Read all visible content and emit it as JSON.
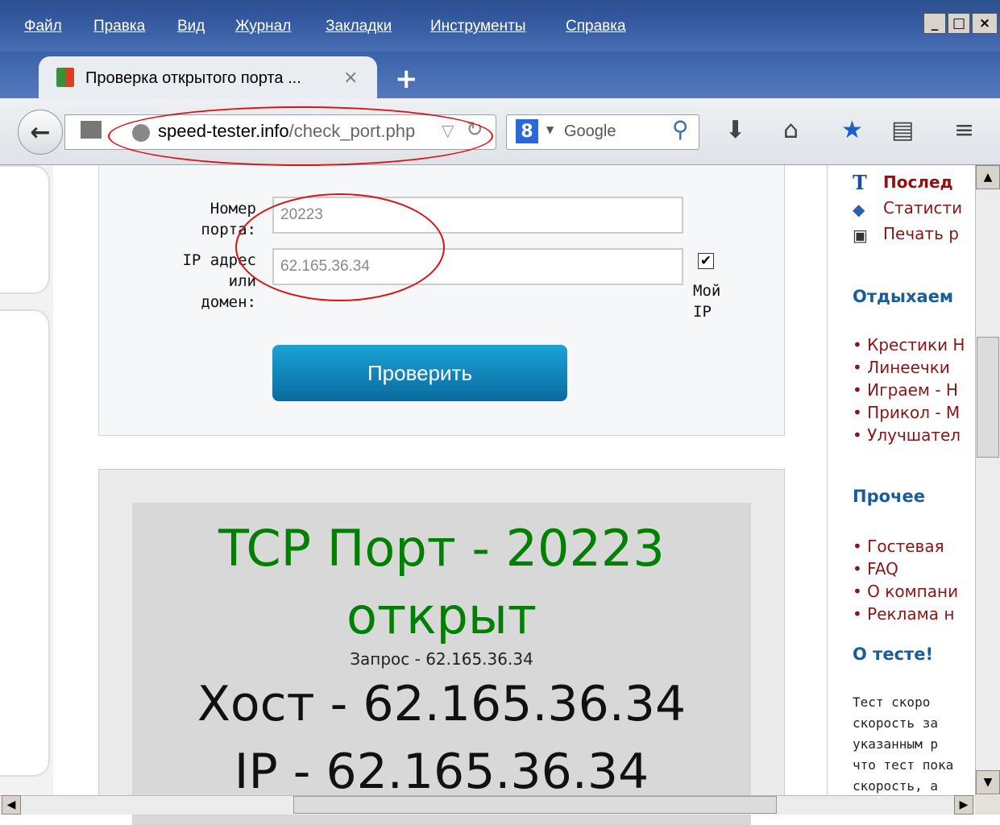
{
  "menu": {
    "items": [
      "Файл",
      "Правка",
      "Вид",
      "Журнал",
      "Закладки",
      "Инструменты",
      "Справка"
    ]
  },
  "window_controls": {
    "minimize": "_",
    "maximize": "□",
    "close": "×"
  },
  "tab": {
    "title": "Проверка открытого порта ...",
    "close": "×",
    "new_tab": "+"
  },
  "urlbar": {
    "host": "speed-tester.info",
    "path": "/check_port.php"
  },
  "search": {
    "engine_label": "8",
    "placeholder": "Google"
  },
  "form": {
    "port_label": "Номер\nпорта:",
    "port_value": "20223",
    "ip_label": "IP адрес\nили\nдомен:",
    "ip_value": "62.165.36.34",
    "myip_checked": true,
    "myip_label": "Мой\nIP",
    "submit_label": "Проверить"
  },
  "result": {
    "title_line1": "TCP Порт - 20223",
    "title_line2": "открыт",
    "title_color": "#008000",
    "query": "Запрос - 62.165.36.34",
    "host": "Хост - 62.165.36.34",
    "ip": "IP - 62.165.36.34"
  },
  "sidebar": {
    "top_links": [
      {
        "icon": "T",
        "text": "Послед",
        "bold": true
      },
      {
        "icon": "◆",
        "text": "Статисти",
        "bold": false
      },
      {
        "icon": "▣",
        "text": "Печать р",
        "bold": false
      }
    ],
    "relax_heading": "Отдыхаем",
    "relax_links": [
      "• Крестики Н",
      "• Линеечки",
      "• Играем - Н",
      "• Прикол - М",
      "• Улучшател"
    ],
    "other_heading": "Прочее",
    "other_links": [
      "• Гостевая",
      "• FAQ",
      "• О компани",
      "• Реклама н"
    ],
    "about_heading": "О тесте!",
    "about_text": [
      "Тест  скоро",
      "скорость  за",
      "указанным  р",
      "что тест пока",
      "скорость,   а"
    ]
  }
}
